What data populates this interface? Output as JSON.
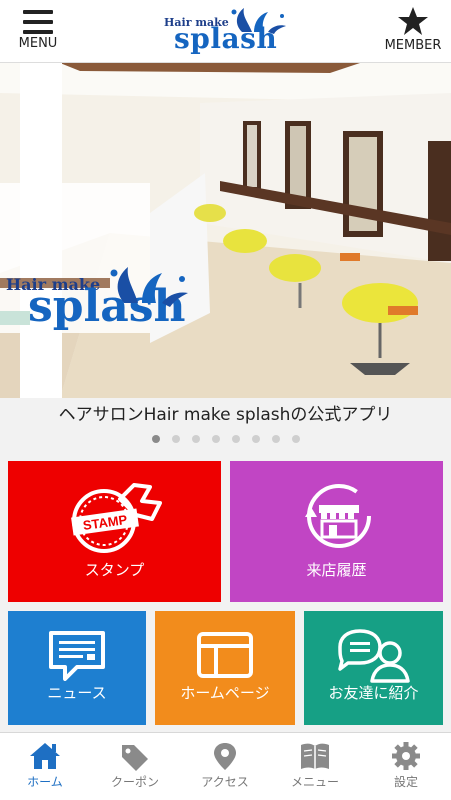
{
  "header": {
    "menu_label": "MENU",
    "member_label": "MEMBER",
    "logo_small": "Hair make",
    "logo_main": "splash"
  },
  "hero": {
    "logo_small": "Hair make",
    "logo_main": "splash",
    "caption": "ヘアサロンHair make splashの公式アプリ",
    "slide_count": 8,
    "active_slide": 1
  },
  "tiles": [
    {
      "label": "スタンプ",
      "icon": "stamp-icon",
      "stamp_text": "STAMP",
      "color": "#ee0000"
    },
    {
      "label": "来店履歴",
      "icon": "shop-history-icon",
      "color": "#c145c4"
    },
    {
      "label": "ニュース",
      "icon": "news-icon",
      "color": "#1e7fd0"
    },
    {
      "label": "ホームページ",
      "icon": "homepage-icon",
      "color": "#f28c1c"
    },
    {
      "label": "お友達に紹介",
      "icon": "friend-icon",
      "color": "#16a085"
    }
  ],
  "tabbar": [
    {
      "label": "ホーム",
      "icon": "home-icon",
      "active": true
    },
    {
      "label": "クーポン",
      "icon": "coupon-icon",
      "active": false
    },
    {
      "label": "アクセス",
      "icon": "map-pin-icon",
      "active": false
    },
    {
      "label": "メニュー",
      "icon": "book-icon",
      "active": false
    },
    {
      "label": "設定",
      "icon": "gear-icon",
      "active": false
    }
  ],
  "colors": {
    "accent": "#1e6fc3",
    "header_bg": "#ffffff"
  }
}
